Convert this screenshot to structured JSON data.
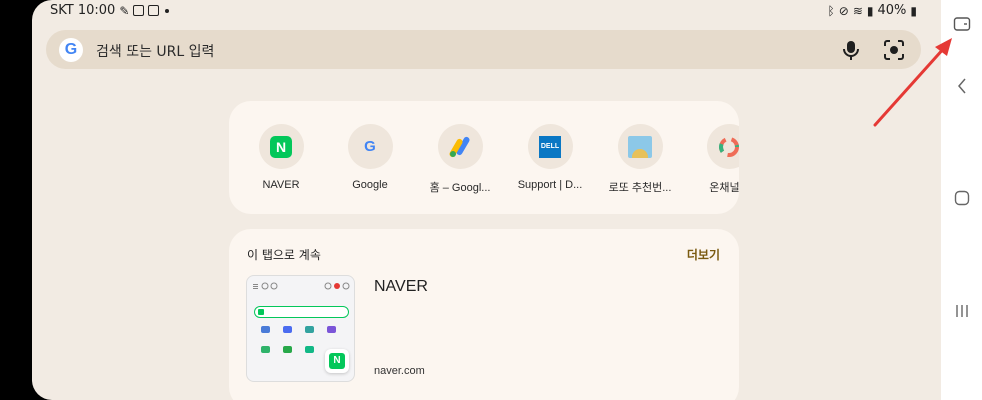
{
  "status_bar": {
    "carrier_time": "SKT 10:00",
    "battery": "40%"
  },
  "search": {
    "placeholder": "검색 또는 URL 입력",
    "logo_letter": "G"
  },
  "shortcuts": [
    {
      "label": "NAVER",
      "icon": "naver-icon"
    },
    {
      "label": "Google",
      "icon": "google-icon"
    },
    {
      "label": "홈 – Googl...",
      "icon": "google-ads-icon"
    },
    {
      "label": "Support | D...",
      "icon": "dell-icon"
    },
    {
      "label": "로또 추천번...",
      "icon": "lotto-icon"
    },
    {
      "label": "온채널 ::",
      "icon": "onchannel-icon"
    }
  ],
  "shortcut_icon_text": {
    "naver": "N",
    "google": "G",
    "dell": "DELL"
  },
  "continue_section": {
    "title": "이 탭으로 계속",
    "more_label": "더보기",
    "tab_title": "NAVER",
    "tab_url": "naver.com",
    "thumb_badge": "N"
  },
  "colors": {
    "background": "#f2ebe3",
    "card": "#fcf6f0",
    "search_bar": "#e6dbcc",
    "naver_green": "#03c75a",
    "annotation_arrow": "#e53935"
  }
}
